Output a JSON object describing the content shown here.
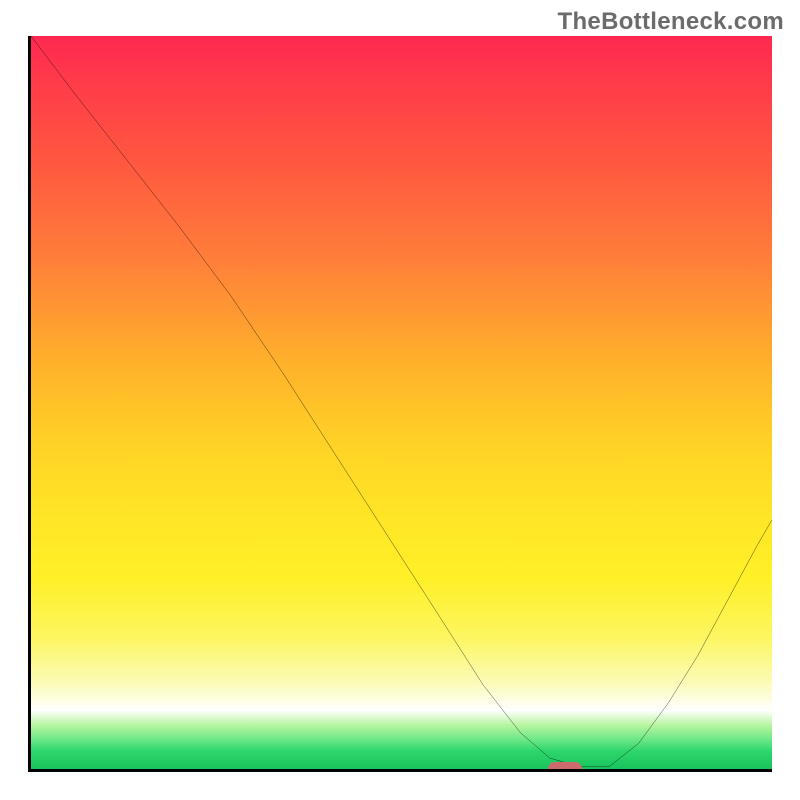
{
  "watermark": "TheBottleneck.com",
  "chart_data": {
    "type": "line",
    "title": "",
    "xlabel": "",
    "ylabel": "",
    "xlim": [
      0,
      100
    ],
    "ylim": [
      0,
      100
    ],
    "grid": false,
    "background_gradient": {
      "direction": "vertical",
      "stops": [
        {
          "pos": 0.0,
          "color": "#ff2850"
        },
        {
          "pos": 0.06,
          "color": "#ff3a4a"
        },
        {
          "pos": 0.16,
          "color": "#ff5440"
        },
        {
          "pos": 0.3,
          "color": "#ff7d3a"
        },
        {
          "pos": 0.45,
          "color": "#ffb22a"
        },
        {
          "pos": 0.56,
          "color": "#ffd326"
        },
        {
          "pos": 0.66,
          "color": "#ffe626"
        },
        {
          "pos": 0.74,
          "color": "#fff028"
        },
        {
          "pos": 0.82,
          "color": "#fdf660"
        },
        {
          "pos": 0.88,
          "color": "#fbfbb4"
        },
        {
          "pos": 0.92,
          "color": "#ffffff"
        },
        {
          "pos": 0.94,
          "color": "#b8f5a0"
        },
        {
          "pos": 0.96,
          "color": "#6be886"
        },
        {
          "pos": 0.975,
          "color": "#2fd66e"
        },
        {
          "pos": 1.0,
          "color": "#18c45b"
        }
      ]
    },
    "series": [
      {
        "name": "bottleneck-curve",
        "color": "#000000",
        "stroke_width": 2,
        "x": [
          0.0,
          6.0,
          13.0,
          20.0,
          27.0,
          34.0,
          41.0,
          48.0,
          55.0,
          61.0,
          66.0,
          70.0,
          74.0,
          78.0,
          82.0,
          86.0,
          90.0,
          94.0,
          98.0,
          100.0
        ],
        "y": [
          100.0,
          92.0,
          83.0,
          74.0,
          64.5,
          54.0,
          43.0,
          32.0,
          21.0,
          11.5,
          5.0,
          1.5,
          0.3,
          0.3,
          3.5,
          9.0,
          15.5,
          23.0,
          30.5,
          34.0
        ]
      }
    ],
    "annotations": [
      {
        "name": "optimal-marker",
        "shape": "pill",
        "color": "#cd6a6e",
        "x": 72.0,
        "y": 0.0
      }
    ]
  }
}
